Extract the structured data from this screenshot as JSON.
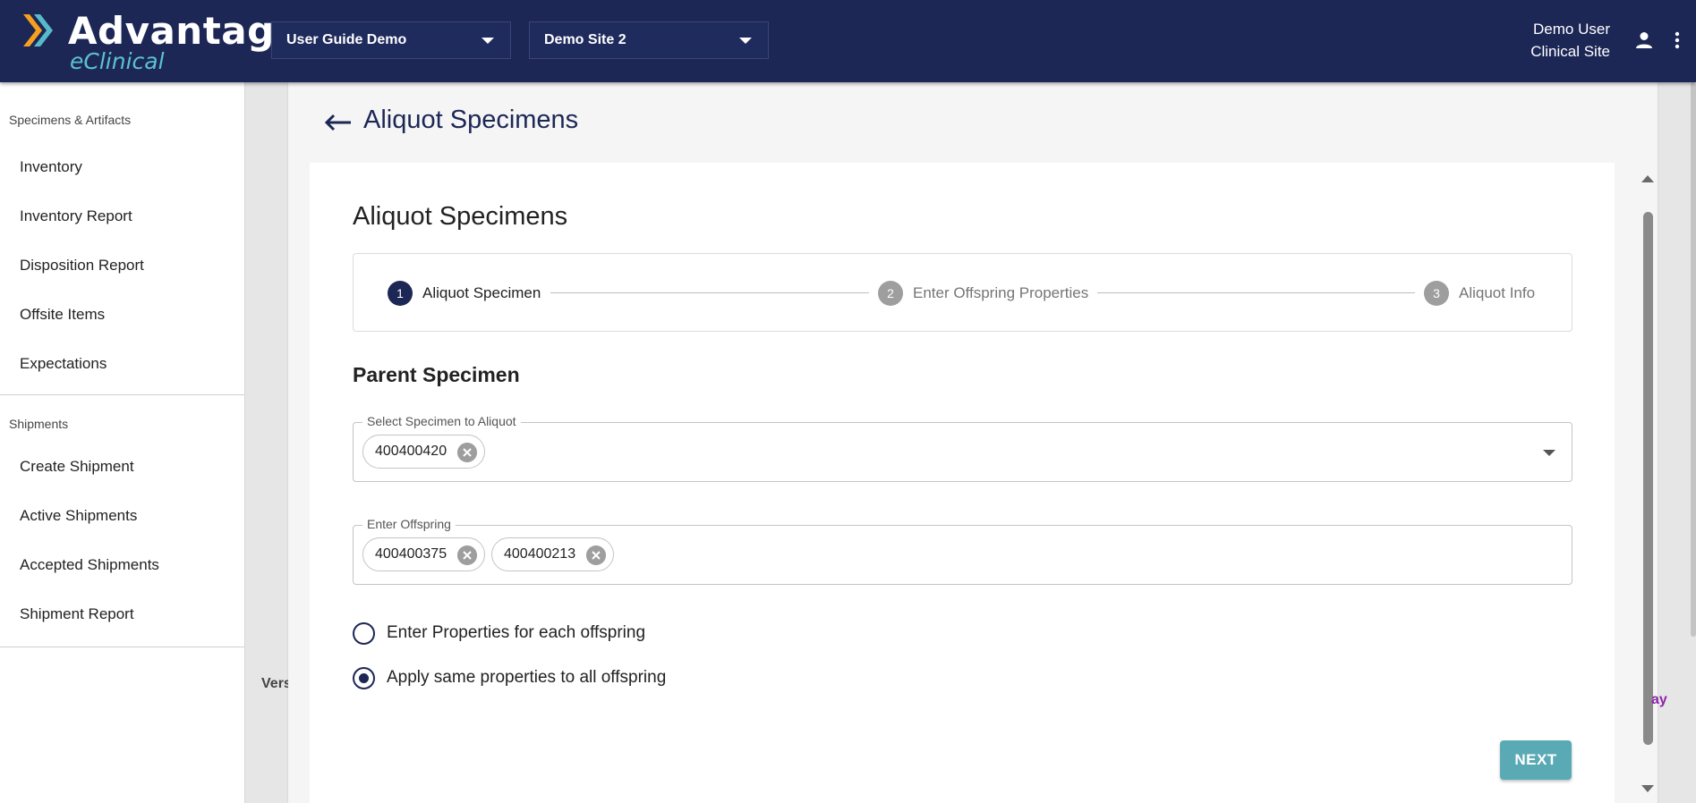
{
  "header": {
    "logo_title": "Advantage",
    "logo_subtitle": "eClinical",
    "study_select": "User Guide Demo",
    "site_select": "Demo Site 2",
    "user_name": "Demo User",
    "user_role": "Clinical Site",
    "icons": [
      "chevron-logo-icon",
      "caret-down-icon",
      "person-icon",
      "more-vert-icon"
    ],
    "colors": {
      "header_bg": "#1c2756",
      "logo_accent": "#5cc1d2",
      "logo_arrow_orange": "#f5a01e"
    }
  },
  "sidebar": {
    "sections": [
      {
        "title": "Specimens & Artifacts",
        "items": [
          "Inventory",
          "Inventory Report",
          "Disposition Report",
          "Offsite Items",
          "Expectations"
        ]
      },
      {
        "title": "Shipments",
        "items": [
          "Create Shipment",
          "Active Shipments",
          "Accepted Shipments",
          "Shipment Report"
        ]
      }
    ]
  },
  "page": {
    "heading": "Aliquot Specimens",
    "form_title": "Aliquot Specimens",
    "steps": [
      {
        "number": "1",
        "label": "Aliquot Specimen",
        "state": "active"
      },
      {
        "number": "2",
        "label": "Enter Offspring Properties",
        "state": "inactive"
      },
      {
        "number": "3",
        "label": "Aliquot Info",
        "state": "inactive"
      }
    ],
    "section_title": "Parent Specimen",
    "parent_field": {
      "label": "Select Specimen to Aliquot",
      "chips": [
        "400400420"
      ]
    },
    "offspring_field": {
      "label": "Enter Offspring",
      "chips": [
        "400400375",
        "400400213"
      ]
    },
    "radio_options": [
      {
        "label": "Enter Properties for each offspring",
        "checked": false
      },
      {
        "label": "Apply same properties to all offspring",
        "checked": true
      }
    ],
    "next_button": "NEXT",
    "fragment_left": "Vers",
    "fragment_right": "ay",
    "colors": {
      "primary": "#1c2756",
      "step_inactive": "#9e9e9e",
      "next_button": "#5aaab5"
    }
  }
}
